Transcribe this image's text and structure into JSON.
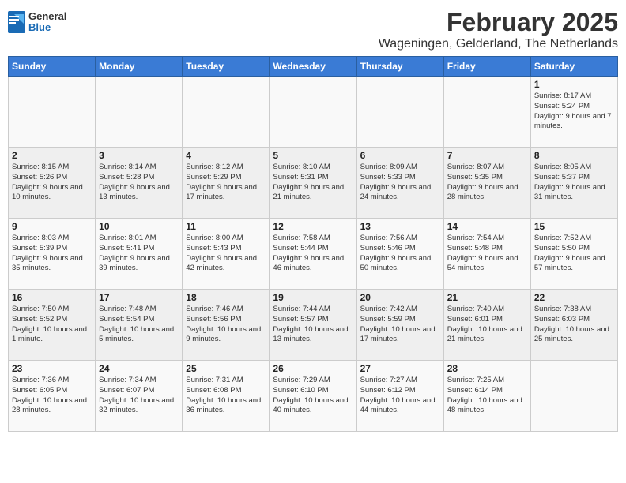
{
  "logo": {
    "general": "General",
    "blue": "Blue"
  },
  "title": "February 2025",
  "location": "Wageningen, Gelderland, The Netherlands",
  "weekdays": [
    "Sunday",
    "Monday",
    "Tuesday",
    "Wednesday",
    "Thursday",
    "Friday",
    "Saturday"
  ],
  "weeks": [
    [
      {
        "day": "",
        "info": ""
      },
      {
        "day": "",
        "info": ""
      },
      {
        "day": "",
        "info": ""
      },
      {
        "day": "",
        "info": ""
      },
      {
        "day": "",
        "info": ""
      },
      {
        "day": "",
        "info": ""
      },
      {
        "day": "1",
        "info": "Sunrise: 8:17 AM\nSunset: 5:24 PM\nDaylight: 9 hours and 7 minutes."
      }
    ],
    [
      {
        "day": "2",
        "info": "Sunrise: 8:15 AM\nSunset: 5:26 PM\nDaylight: 9 hours and 10 minutes."
      },
      {
        "day": "3",
        "info": "Sunrise: 8:14 AM\nSunset: 5:28 PM\nDaylight: 9 hours and 13 minutes."
      },
      {
        "day": "4",
        "info": "Sunrise: 8:12 AM\nSunset: 5:29 PM\nDaylight: 9 hours and 17 minutes."
      },
      {
        "day": "5",
        "info": "Sunrise: 8:10 AM\nSunset: 5:31 PM\nDaylight: 9 hours and 21 minutes."
      },
      {
        "day": "6",
        "info": "Sunrise: 8:09 AM\nSunset: 5:33 PM\nDaylight: 9 hours and 24 minutes."
      },
      {
        "day": "7",
        "info": "Sunrise: 8:07 AM\nSunset: 5:35 PM\nDaylight: 9 hours and 28 minutes."
      },
      {
        "day": "8",
        "info": "Sunrise: 8:05 AM\nSunset: 5:37 PM\nDaylight: 9 hours and 31 minutes."
      }
    ],
    [
      {
        "day": "9",
        "info": "Sunrise: 8:03 AM\nSunset: 5:39 PM\nDaylight: 9 hours and 35 minutes."
      },
      {
        "day": "10",
        "info": "Sunrise: 8:01 AM\nSunset: 5:41 PM\nDaylight: 9 hours and 39 minutes."
      },
      {
        "day": "11",
        "info": "Sunrise: 8:00 AM\nSunset: 5:43 PM\nDaylight: 9 hours and 42 minutes."
      },
      {
        "day": "12",
        "info": "Sunrise: 7:58 AM\nSunset: 5:44 PM\nDaylight: 9 hours and 46 minutes."
      },
      {
        "day": "13",
        "info": "Sunrise: 7:56 AM\nSunset: 5:46 PM\nDaylight: 9 hours and 50 minutes."
      },
      {
        "day": "14",
        "info": "Sunrise: 7:54 AM\nSunset: 5:48 PM\nDaylight: 9 hours and 54 minutes."
      },
      {
        "day": "15",
        "info": "Sunrise: 7:52 AM\nSunset: 5:50 PM\nDaylight: 9 hours and 57 minutes."
      }
    ],
    [
      {
        "day": "16",
        "info": "Sunrise: 7:50 AM\nSunset: 5:52 PM\nDaylight: 10 hours and 1 minute."
      },
      {
        "day": "17",
        "info": "Sunrise: 7:48 AM\nSunset: 5:54 PM\nDaylight: 10 hours and 5 minutes."
      },
      {
        "day": "18",
        "info": "Sunrise: 7:46 AM\nSunset: 5:56 PM\nDaylight: 10 hours and 9 minutes."
      },
      {
        "day": "19",
        "info": "Sunrise: 7:44 AM\nSunset: 5:57 PM\nDaylight: 10 hours and 13 minutes."
      },
      {
        "day": "20",
        "info": "Sunrise: 7:42 AM\nSunset: 5:59 PM\nDaylight: 10 hours and 17 minutes."
      },
      {
        "day": "21",
        "info": "Sunrise: 7:40 AM\nSunset: 6:01 PM\nDaylight: 10 hours and 21 minutes."
      },
      {
        "day": "22",
        "info": "Sunrise: 7:38 AM\nSunset: 6:03 PM\nDaylight: 10 hours and 25 minutes."
      }
    ],
    [
      {
        "day": "23",
        "info": "Sunrise: 7:36 AM\nSunset: 6:05 PM\nDaylight: 10 hours and 28 minutes."
      },
      {
        "day": "24",
        "info": "Sunrise: 7:34 AM\nSunset: 6:07 PM\nDaylight: 10 hours and 32 minutes."
      },
      {
        "day": "25",
        "info": "Sunrise: 7:31 AM\nSunset: 6:08 PM\nDaylight: 10 hours and 36 minutes."
      },
      {
        "day": "26",
        "info": "Sunrise: 7:29 AM\nSunset: 6:10 PM\nDaylight: 10 hours and 40 minutes."
      },
      {
        "day": "27",
        "info": "Sunrise: 7:27 AM\nSunset: 6:12 PM\nDaylight: 10 hours and 44 minutes."
      },
      {
        "day": "28",
        "info": "Sunrise: 7:25 AM\nSunset: 6:14 PM\nDaylight: 10 hours and 48 minutes."
      },
      {
        "day": "",
        "info": ""
      }
    ]
  ]
}
